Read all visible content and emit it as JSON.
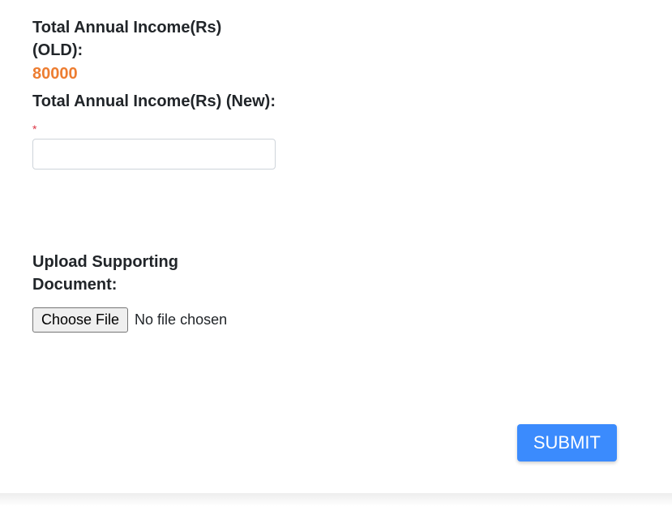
{
  "incomeOld": {
    "label": "Total Annual Income(Rs) (OLD):",
    "value": "80000"
  },
  "incomeNew": {
    "label": "Total Annual Income(Rs) (New):",
    "requiredMark": "*",
    "value": ""
  },
  "upload": {
    "label": "Upload Supporting Document:",
    "buttonLabel": "Choose File",
    "statusText": "No file chosen"
  },
  "submit": {
    "label": "SUBMIT"
  }
}
